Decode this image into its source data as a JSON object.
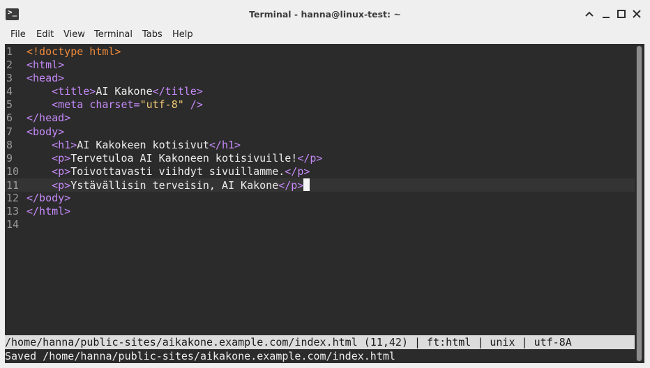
{
  "window": {
    "title": "Terminal - hanna@linux-test: ~",
    "app_icon_glyph": ">_",
    "controls": [
      "up-arrow-icon",
      "minimize-icon",
      "maximize-icon",
      "close-icon"
    ]
  },
  "menu": {
    "items": [
      "File",
      "Edit",
      "View",
      "Terminal",
      "Tabs",
      "Help"
    ]
  },
  "editor": {
    "line_numbers": [
      "1",
      "2",
      "3",
      "4",
      "5",
      "6",
      "7",
      "8",
      "9",
      "10",
      "11",
      "12",
      "13",
      "14"
    ],
    "lines": {
      "l1": {
        "doctype": "<!doctype html>"
      },
      "l2": {
        "open": "<html>"
      },
      "l3": {
        "open": "<head>"
      },
      "l4": {
        "indent": "    ",
        "open": "<title>",
        "text": "AI Kakone",
        "close": "</title>"
      },
      "l5": {
        "indent": "    ",
        "open": "<meta ",
        "attr": "charset=",
        "value": "\"utf-8\"",
        "close": " />"
      },
      "l6": {
        "close": "</head>"
      },
      "l7": {
        "open": "<body>"
      },
      "l8": {
        "indent": "    ",
        "open": "<h1>",
        "text": "AI Kakokeen kotisivut",
        "close": "</h1>"
      },
      "l9": {
        "indent": "    ",
        "open": "<p>",
        "text": "Tervetuloa AI Kakoneen kotisivuille!",
        "close": "</p>"
      },
      "l10": {
        "indent": "    ",
        "open": "<p>",
        "text": "Toivottavasti viihdyt sivuillamme.",
        "close": "</p>"
      },
      "l11": {
        "indent": "    ",
        "open": "<p>",
        "text": "Ystävällisin terveisin, AI Kakone",
        "close": "</p>"
      },
      "l12": {
        "close": "</body>"
      },
      "l13": {
        "close": "</html>"
      }
    },
    "status_line": "/home/hanna/public-sites/aikakone.example.com/index.html (11,42) | ft:html | unix | utf-8A",
    "message_line": "Saved /home/hanna/public-sites/aikakone.example.com/index.html",
    "colors": {
      "background": "#2b2b2b",
      "tag": "#c58af9",
      "doctype": "#f08a3a",
      "string": "#f0c674",
      "line_number": "#9a9a9a"
    }
  }
}
